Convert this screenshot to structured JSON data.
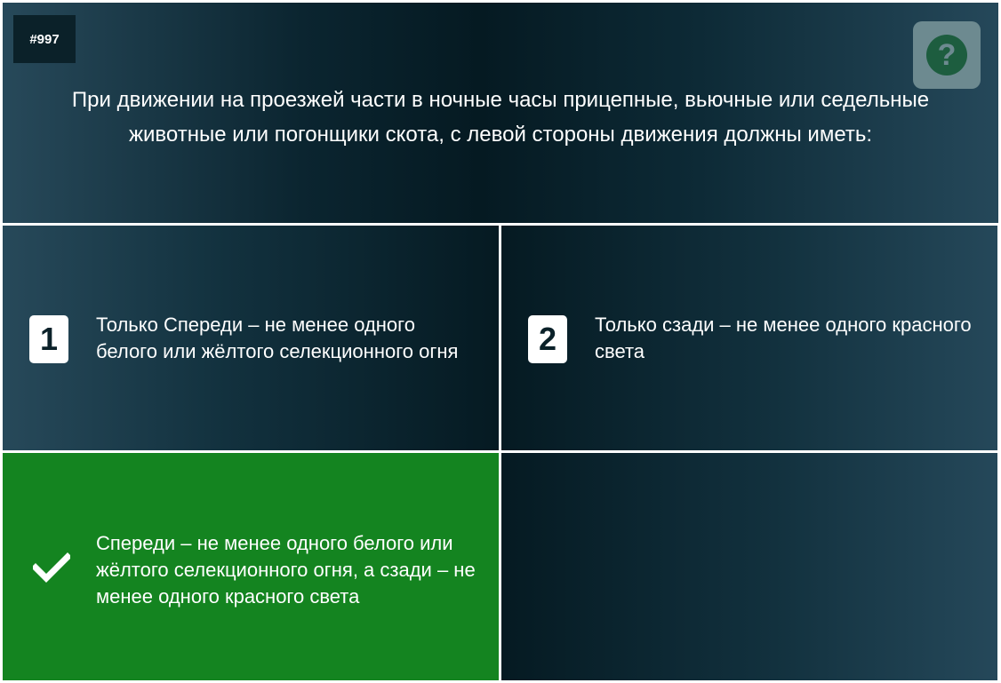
{
  "question": {
    "number": "#997",
    "text": "При движении на проезжей части в ночные часы прицепные, вьючные или седельные животные или погонщики скота, с левой стороны движения должны иметь:",
    "help_icon": "question-circle-icon",
    "help_label": "?"
  },
  "answers": [
    {
      "badge": "1",
      "text": "Только Спереди – не менее одного белого или жёлтого селекционного огня",
      "state": "default"
    },
    {
      "badge": "2",
      "text": "Только сзади – не менее одного красного света",
      "state": "default"
    },
    {
      "badge_icon": "checkmark-icon",
      "text": "Спереди – не менее одного белого или жёлтого селекционного огня, а сзади – не менее одного красного света",
      "state": "correct"
    },
    {
      "text": "",
      "state": "empty"
    }
  ],
  "colors": {
    "correct": "#148420",
    "dark": "#051a22",
    "help_bg": "#6d8a90",
    "help_icon": "#1d5d3f"
  }
}
